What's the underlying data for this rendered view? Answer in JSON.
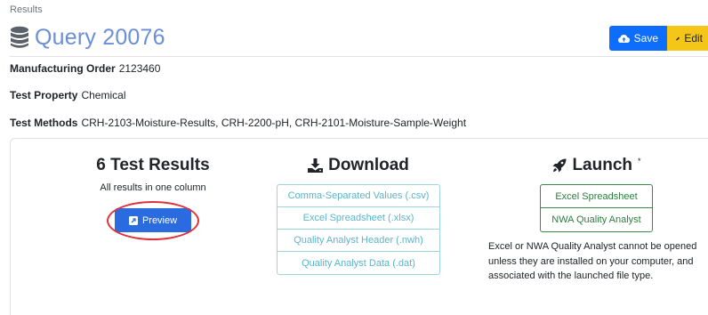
{
  "breadcrumb": "Results",
  "page": {
    "title": "Query 20076"
  },
  "toolbar": {
    "save_label": "Save",
    "edit_label": "Edit"
  },
  "meta": {
    "manufacturing_order": {
      "label": "Manufacturing Order",
      "value": "2123460"
    },
    "test_property": {
      "label": "Test Property",
      "value": "Chemical"
    },
    "test_methods": {
      "label": "Test Methods",
      "value": "CRH-2103-Moisture-Results, CRH-2200-pH, CRH-2101-Moisture-Sample-Weight"
    }
  },
  "results": {
    "title": "6 Test Results",
    "subtitle": "All results in one column",
    "preview_label": "Preview"
  },
  "download": {
    "title": "Download",
    "items": [
      "Comma-Separated Values (.csv)",
      "Excel Spreadsheet (.xlsx)",
      "Quality Analyst Header (.nwh)",
      "Quality Analyst Data (.dat)"
    ]
  },
  "launch": {
    "title": "Launch",
    "superscript": "*",
    "items": [
      "Excel Spreadsheet",
      "NWA Quality Analyst"
    ],
    "note": "Excel or NWA Quality Analyst cannot be opened unless they are installed on your computer, and associated with the launched file type."
  },
  "icons": {
    "title": "database-icon",
    "save": "cloud-upload-icon",
    "edit": "pencil-icon",
    "preview": "external-link-icon",
    "download": "download-icon",
    "launch": "rocket-icon"
  },
  "colors": {
    "title": "#6b8ed6",
    "save": "#0d6efd",
    "edit": "#f5c518",
    "preview": "#2a6be0",
    "download_outline": "#5ab5ca",
    "launch_outline": "#2f7d3e",
    "highlight_circle": "#e0313a"
  }
}
